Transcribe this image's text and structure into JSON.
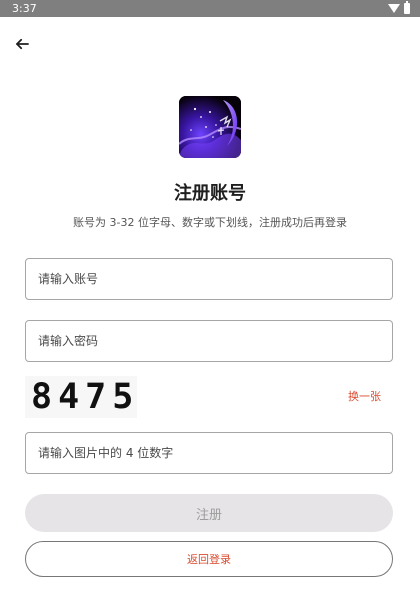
{
  "status_bar": {
    "time": "3:37",
    "icons": [
      "wifi-icon",
      "battery-icon"
    ]
  },
  "header": {
    "back_icon": "arrow-left-icon"
  },
  "logo": {
    "icon": "app-logo-icon"
  },
  "register": {
    "title": "注册账号",
    "subtitle": "账号为 3-32 位字母、数字或下划线，注册成功后再登录",
    "account_placeholder": "请输入账号",
    "password_placeholder": "请输入密码",
    "captcha_text": "8475",
    "refresh_captcha": "换一张",
    "captcha_placeholder": "请输入图片中的 4 位数字",
    "register_button": "注册",
    "back_to_login_button": "返回登录"
  },
  "colors": {
    "accent": "#d94b2f",
    "disabled_button_bg": "#e6e4e7",
    "disabled_button_text": "#9d9d9d",
    "status_bar_bg": "#7f7f7f"
  }
}
